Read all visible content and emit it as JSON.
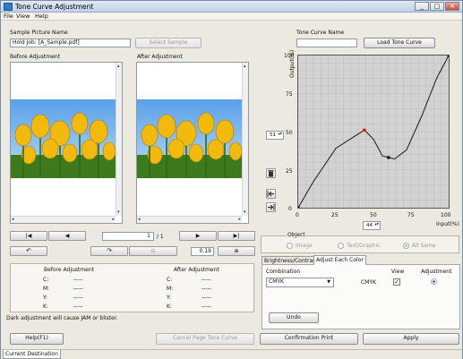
{
  "window": {
    "title": "Tone Curve Adjustment",
    "close": "✕",
    "min": "_",
    "max": "□"
  },
  "menu": [
    "File",
    "View",
    "Help"
  ],
  "sample": {
    "label": "Sample Picture Name",
    "value": "Hold Job: [A_Sample.pdf]",
    "select_button": "Select Sample"
  },
  "tone": {
    "label": "Tone Curve Name",
    "value": "",
    "load_button": "Load Tone Curve"
  },
  "before": {
    "label": "Before Adjustment"
  },
  "after": {
    "label": "After Adjustment"
  },
  "nav": {
    "page": "1",
    "total": "/ 1",
    "first": "|◀",
    "prev": "◀",
    "next": "▶",
    "last": "▶|",
    "zoom": "0.19"
  },
  "info": {
    "before_title": "Before Adjustment",
    "after_title": "After Adjustment",
    "rows": [
      {
        "k": "C:",
        "b": "-----",
        "a": "-----"
      },
      {
        "k": "M:",
        "b": "-----",
        "a": "-----"
      },
      {
        "k": "Y:",
        "b": "-----",
        "a": "-----"
      },
      {
        "k": "K:",
        "b": "-----",
        "a": "-----"
      }
    ]
  },
  "warning": "Dark adjustment will cause JAM or blister.",
  "graph": {
    "ylabel": "Output(%)",
    "xlabel": "Input(%)",
    "yticks": [
      "100",
      "75",
      "50",
      "25",
      "0"
    ],
    "xticks": [
      "0",
      "25",
      "50",
      "75",
      "100"
    ],
    "output_value": "51",
    "input_value": "44",
    "curve": [
      [
        0,
        0
      ],
      [
        10,
        17
      ],
      [
        25,
        39
      ],
      [
        36,
        46
      ],
      [
        44,
        51
      ],
      [
        50,
        45
      ],
      [
        56,
        34
      ],
      [
        64,
        32
      ],
      [
        72,
        38
      ],
      [
        82,
        60
      ],
      [
        92,
        85
      ],
      [
        100,
        100
      ]
    ],
    "points": [
      [
        0,
        0
      ],
      [
        44,
        51
      ],
      [
        60,
        33
      ],
      [
        100,
        100
      ]
    ],
    "selected_point": [
      44,
      51
    ]
  },
  "object": {
    "legend": "Object",
    "options": [
      "Image",
      "Text/Graphic",
      "All Same"
    ],
    "selected": "All Same"
  },
  "tabs": [
    "Brightness/Contrast",
    "Adjust Each Color"
  ],
  "adjust": {
    "col_combination": "Combination",
    "col_view": "View",
    "col_adjustment": "Adjustment",
    "combination": "CMYK",
    "channel": "CMYK",
    "undo": "Undo"
  },
  "footer": {
    "help": "Help(F1)",
    "cancel": "Cancel Page Tone Curve",
    "confirm": "Confirmation Print",
    "apply": "Apply"
  },
  "status": {
    "tab": "Current Destination"
  },
  "colors": {
    "curve_point": "#cc1111",
    "accent": "#2f7cd0"
  }
}
